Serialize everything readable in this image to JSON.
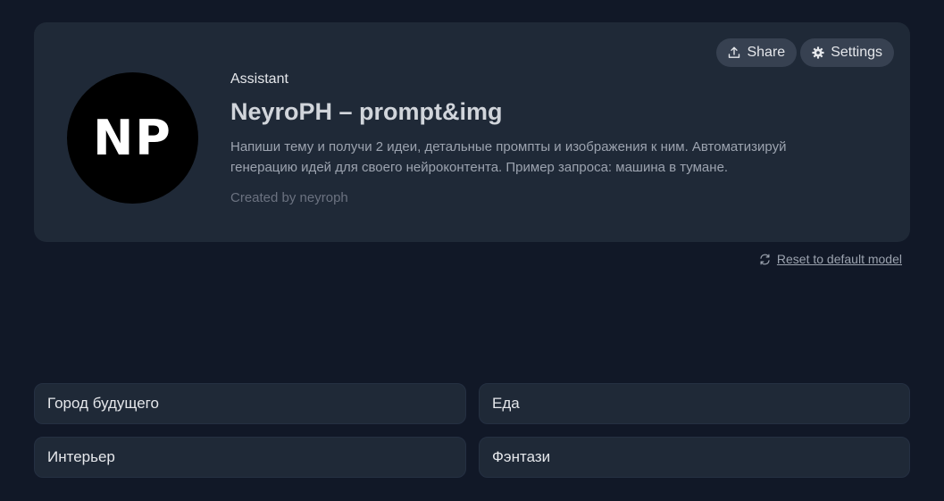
{
  "header": {
    "avatar_initials": "NP",
    "kind": "Assistant",
    "title": "NeyroPH – prompt&img",
    "description": "Напиши тему и получи 2 идеи, детальные промпты и изображения к ним. Автоматизируй генерацию идей для своего нейроконтента. Пример запроса: машина в тумане.",
    "creator": "Created by neyroph"
  },
  "actions": {
    "share_label": "Share",
    "settings_label": "Settings"
  },
  "reset": {
    "label": "Reset to default model"
  },
  "suggestions": [
    {
      "label": "Город будущего"
    },
    {
      "label": "Еда"
    },
    {
      "label": "Интерьер"
    },
    {
      "label": "Фэнтази"
    }
  ],
  "colors": {
    "background": "#111827",
    "card": "#1f2937",
    "button": "#374151"
  }
}
